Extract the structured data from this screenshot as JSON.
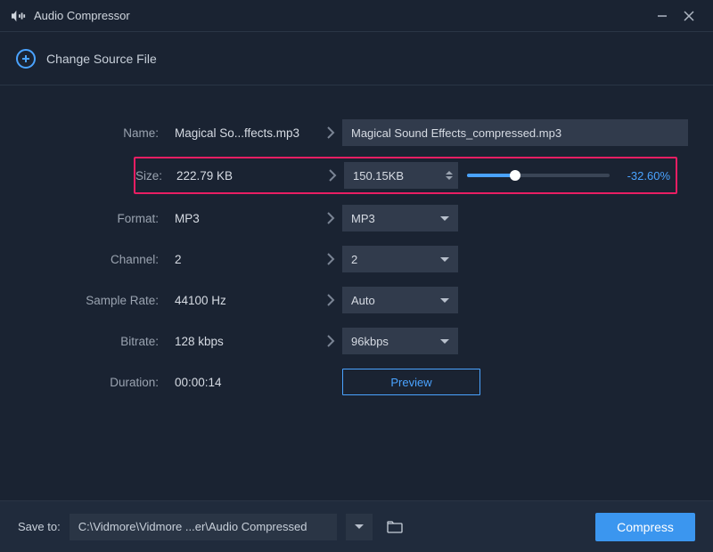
{
  "app": {
    "title": "Audio Compressor"
  },
  "subbar": {
    "change_source": "Change Source File"
  },
  "labels": {
    "name": "Name:",
    "size": "Size:",
    "format": "Format:",
    "channel": "Channel:",
    "sample_rate": "Sample Rate:",
    "bitrate": "Bitrate:",
    "duration": "Duration:"
  },
  "source": {
    "name": "Magical So...ffects.mp3",
    "size": "222.79 KB",
    "format": "MP3",
    "channel": "2",
    "sample_rate": "44100 Hz",
    "bitrate": "128 kbps",
    "duration": "00:00:14"
  },
  "target": {
    "name": "Magical Sound Effects_compressed.mp3",
    "size": "150.15KB",
    "size_pct": "-32.60%",
    "format": "MP3",
    "channel": "2",
    "sample_rate": "Auto",
    "bitrate": "96kbps"
  },
  "buttons": {
    "preview": "Preview",
    "compress": "Compress"
  },
  "footer": {
    "save_to_label": "Save to:",
    "path": "C:\\Vidmore\\Vidmore ...er\\Audio Compressed"
  }
}
